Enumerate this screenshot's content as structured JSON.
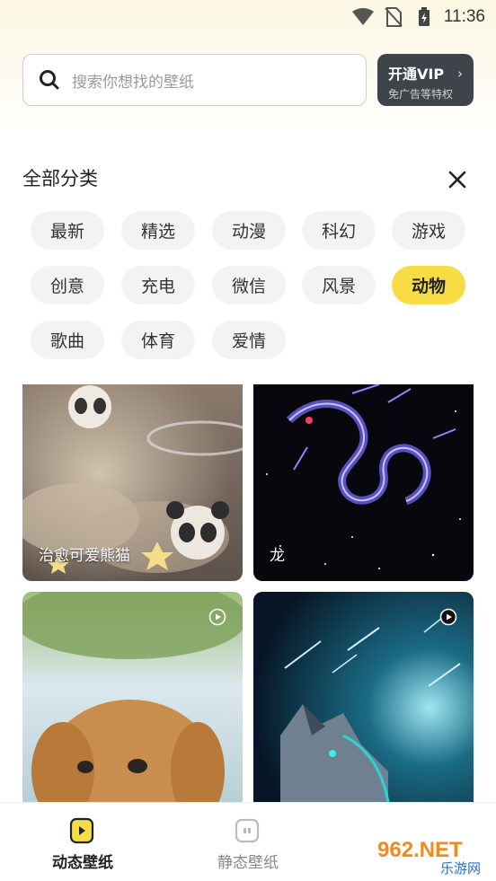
{
  "status_bar": {
    "time": "11:36",
    "icons": [
      "wifi-icon",
      "no-sim-icon",
      "battery-charging-icon"
    ]
  },
  "search": {
    "placeholder": "搜索你想找的壁纸",
    "icon": "search-icon"
  },
  "vip": {
    "title": "开通VIP",
    "subtitle": "免广告等特权",
    "chevron": "›"
  },
  "categories": {
    "title": "全部分类",
    "close_icon": "close-icon",
    "items": [
      {
        "label": "最新",
        "active": false
      },
      {
        "label": "精选",
        "active": false
      },
      {
        "label": "动漫",
        "active": false
      },
      {
        "label": "科幻",
        "active": false
      },
      {
        "label": "游戏",
        "active": false
      },
      {
        "label": "创意",
        "active": false
      },
      {
        "label": "充电",
        "active": false
      },
      {
        "label": "微信",
        "active": false
      },
      {
        "label": "风景",
        "active": false
      },
      {
        "label": "动物",
        "active": true
      },
      {
        "label": "歌曲",
        "active": false
      },
      {
        "label": "体育",
        "active": false
      },
      {
        "label": "爱情",
        "active": false
      }
    ],
    "active_color": "#f7dc46"
  },
  "wallpapers": [
    {
      "label": "治愈可爱熊猫",
      "video": false
    },
    {
      "label": "龙",
      "video": false
    },
    {
      "label": "",
      "video": true
    },
    {
      "label": "",
      "video": true
    }
  ],
  "bottom_nav": {
    "items": [
      {
        "label": "动态壁纸",
        "active": true,
        "icon": "play-square-icon"
      },
      {
        "label": "静态壁纸",
        "active": false,
        "icon": "image-square-icon"
      }
    ]
  },
  "watermark": {
    "brand": "962.NET",
    "sub": "乐游网"
  }
}
